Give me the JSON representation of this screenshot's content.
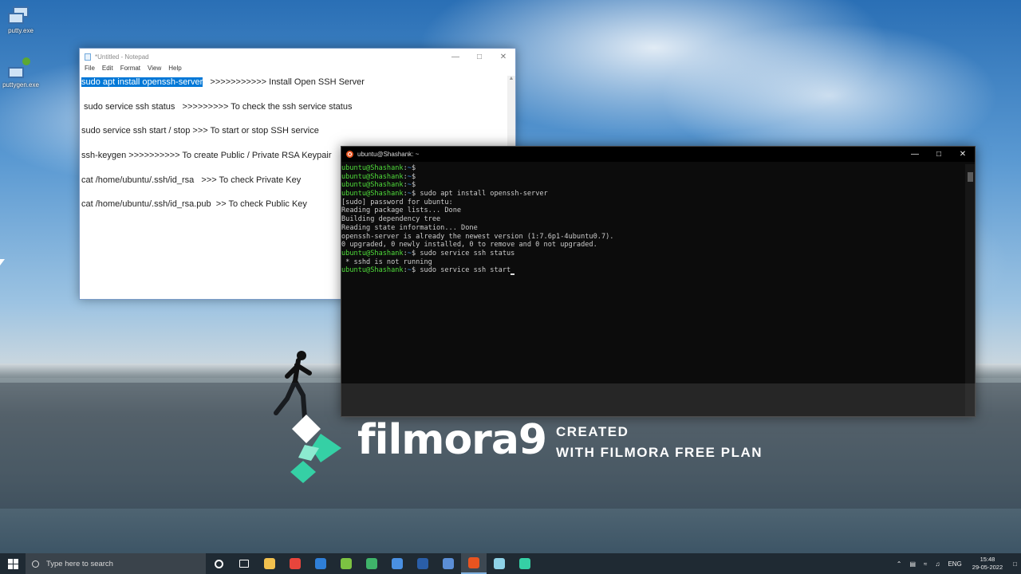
{
  "desktop": {
    "icons": [
      {
        "label": "putty.exe"
      },
      {
        "label": "puttygen.exe"
      }
    ]
  },
  "notepad": {
    "title": "*Untitled - Notepad",
    "menu": [
      "File",
      "Edit",
      "Format",
      "View",
      "Help"
    ],
    "lines": [
      {
        "selected": "sudo apt install openssh-server",
        "rest": "   >>>>>>>>>>> Install Open SSH Server"
      },
      {
        "selected": "",
        "rest": " sudo service ssh status   >>>>>>>>> To check the ssh service status"
      },
      {
        "selected": "",
        "rest": "sudo service ssh start / stop >>> To start or stop SSH service"
      },
      {
        "selected": "",
        "rest": "ssh-keygen >>>>>>>>>> To create Public / Private RSA Keypair"
      },
      {
        "selected": "",
        "rest": "cat /home/ubuntu/.ssh/id_rsa   >>> To check Private Key"
      },
      {
        "selected": "",
        "rest": "cat /home/ubuntu/.ssh/id_rsa.pub  >> To check Public Key"
      }
    ]
  },
  "terminal": {
    "title": "ubuntu@Shashank: ~",
    "prompt_user": "ubuntu@Shashank",
    "prompt_path": "~",
    "lines": [
      {
        "type": "prompt",
        "cmd": ""
      },
      {
        "type": "prompt",
        "cmd": ""
      },
      {
        "type": "prompt",
        "cmd": ""
      },
      {
        "type": "prompt",
        "cmd": "sudo apt install openssh-server"
      },
      {
        "type": "out",
        "text": "[sudo] password for ubuntu:"
      },
      {
        "type": "out",
        "text": "Reading package lists... Done"
      },
      {
        "type": "out",
        "text": "Building dependency tree"
      },
      {
        "type": "out",
        "text": "Reading state information... Done"
      },
      {
        "type": "out",
        "text": "openssh-server is already the newest version (1:7.6p1-4ubuntu0.7)."
      },
      {
        "type": "out",
        "text": "0 upgraded, 0 newly installed, 0 to remove and 0 not upgraded."
      },
      {
        "type": "prompt",
        "cmd": "sudo service ssh status"
      },
      {
        "type": "out",
        "text": " * sshd is not running"
      },
      {
        "type": "prompt",
        "cmd": "sudo service ssh start",
        "cursor": true
      }
    ]
  },
  "watermark": {
    "brand": "filmora9",
    "line1": "CREATED",
    "line2": "WITH FILMORA FREE PLAN"
  },
  "taskbar": {
    "search_placeholder": "Type here to search",
    "apps": [
      {
        "icon": "cortana-icon",
        "color": "#ffffff"
      },
      {
        "icon": "task-view-icon",
        "color": "#ffffff"
      },
      {
        "icon": "file-explorer-icon",
        "color": "#f2c14e"
      },
      {
        "icon": "chrome-icon",
        "color": "#e8453c"
      },
      {
        "icon": "app-blue-icon",
        "color": "#2f7fd8"
      },
      {
        "icon": "app-green-icon",
        "color": "#7cc242"
      },
      {
        "icon": "app-globe-icon",
        "color": "#3fb46a"
      },
      {
        "icon": "app-pin-icon",
        "color": "#4a90e2"
      },
      {
        "icon": "powershell-icon",
        "color": "#2a5ea8"
      },
      {
        "icon": "app-disc-icon",
        "color": "#5b8ed6"
      },
      {
        "icon": "ubuntu-icon",
        "color": "#e95420",
        "active": true
      },
      {
        "icon": "notepad-icon",
        "color": "#8fd3e8"
      },
      {
        "icon": "filmora-icon",
        "color": "#35d0a5"
      }
    ],
    "language": "ENG",
    "time": "15:48",
    "date": "29-05-2022"
  }
}
